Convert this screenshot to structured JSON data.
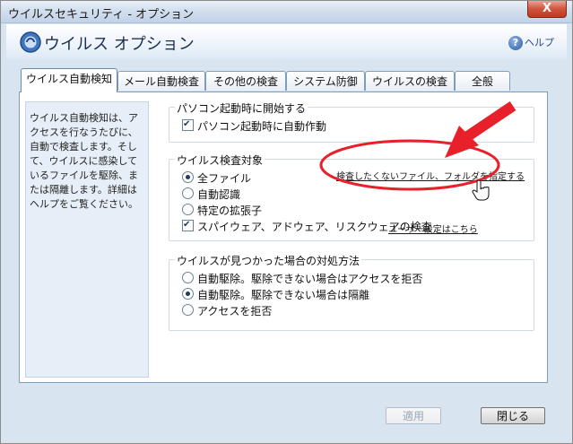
{
  "window": {
    "title": "ウイルスセキュリティ - オプション",
    "close_label": "X"
  },
  "header": {
    "title": "ウイルス オプション",
    "help_label": "ヘルプ",
    "help_glyph": "?"
  },
  "tabs": [
    {
      "label": "ウイルス自動検知",
      "active": true
    },
    {
      "label": "メール自動検査",
      "active": false
    },
    {
      "label": "その他の検査",
      "active": false
    },
    {
      "label": "システム防御",
      "active": false
    },
    {
      "label": "ウイルスの検査",
      "active": false
    },
    {
      "label": "全般",
      "active": false
    }
  ],
  "description": "ウイルス自動検知は、アクセスを行なうたびに、自動で検査します。そして、ウイルスに感染しているファイルを駆除、または隔離します。詳細はヘルプをご覧ください。",
  "startup_group": {
    "title": "パソコン起動時に開始する",
    "checkbox_label": "パソコン起動時に自動作動",
    "checked": true
  },
  "scan_target_group": {
    "title": "ウイルス検査対象",
    "exclude_link": "検査したくないファイル、フォルダを指定する",
    "options": [
      {
        "label": "全ファイル",
        "selected": true
      },
      {
        "label": "自動認識",
        "selected": false
      },
      {
        "label": "特定の拡張子",
        "selected": false
      }
    ],
    "spyware_label": "スパイウェア、アドウェア、リスクウェアの検査",
    "spyware_checked": true,
    "user_settings_link": "ユーザー設定はこちら"
  },
  "action_group": {
    "title": "ウイルスが見つかった場合の対処方法",
    "options": [
      {
        "label": "自動駆除。駆除できない場合はアクセスを拒否",
        "selected": false
      },
      {
        "label": "自動駆除。駆除できない場合は隔離",
        "selected": true
      },
      {
        "label": "アクセスを拒否",
        "selected": false
      }
    ]
  },
  "buttons": {
    "apply_label": "適用",
    "close_label": "閉じる"
  },
  "colors": {
    "annotation_red": "#e8202a",
    "accent_blue": "#2a5aa0"
  }
}
